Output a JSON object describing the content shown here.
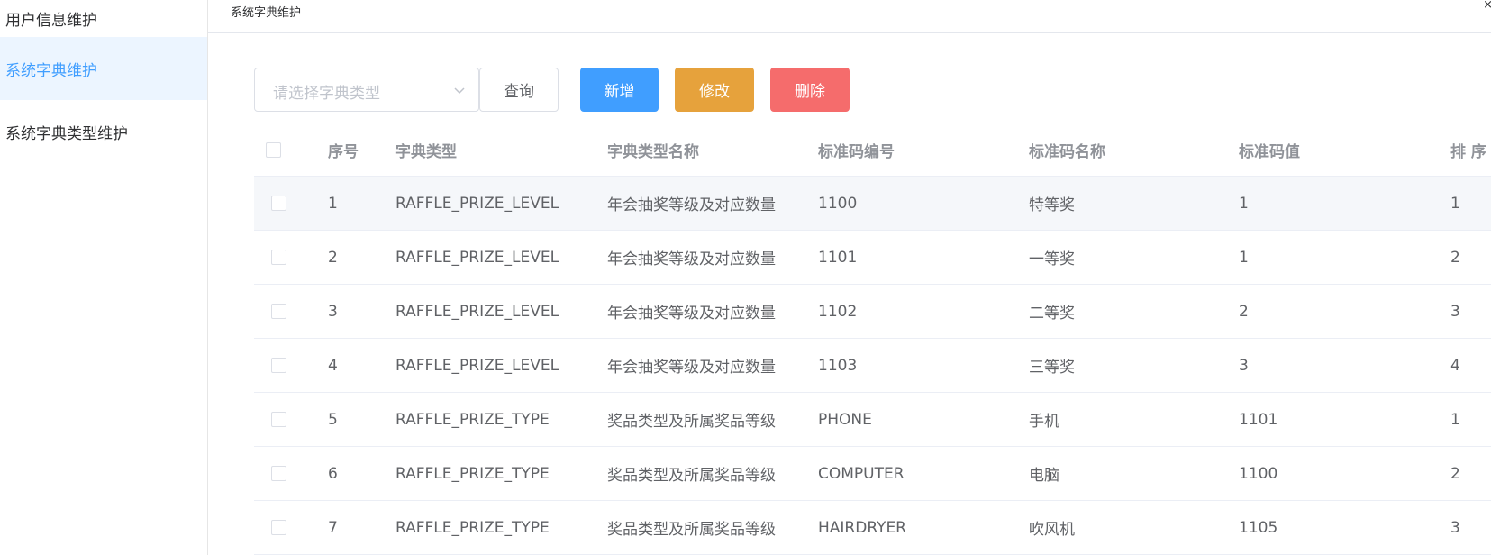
{
  "sidebar": {
    "items": [
      {
        "label": "用户信息维护",
        "active": false
      },
      {
        "label": "系统字典维护",
        "active": true
      },
      {
        "label": "系统字典类型维护",
        "active": false
      }
    ]
  },
  "tab": {
    "title": "系统字典维护",
    "close": "×"
  },
  "toolbar": {
    "select_placeholder": "请选择字典类型",
    "query_label": "查询",
    "add_label": "新增",
    "edit_label": "修改",
    "delete_label": "删除"
  },
  "table": {
    "headers": {
      "index": "序号",
      "dict_type": "字典类型",
      "dict_type_name": "字典类型名称",
      "code": "标准码编号",
      "code_name": "标准码名称",
      "code_value": "标准码值",
      "sort": "排 序"
    },
    "rows": [
      {
        "index": "1",
        "dict_type": "RAFFLE_PRIZE_LEVEL",
        "dict_type_name": "年会抽奖等级及对应数量",
        "code": "1100",
        "code_name": "特等奖",
        "code_value": "1",
        "sort": "1"
      },
      {
        "index": "2",
        "dict_type": "RAFFLE_PRIZE_LEVEL",
        "dict_type_name": "年会抽奖等级及对应数量",
        "code": "1101",
        "code_name": "一等奖",
        "code_value": "1",
        "sort": "2"
      },
      {
        "index": "3",
        "dict_type": "RAFFLE_PRIZE_LEVEL",
        "dict_type_name": "年会抽奖等级及对应数量",
        "code": "1102",
        "code_name": "二等奖",
        "code_value": "2",
        "sort": "3"
      },
      {
        "index": "4",
        "dict_type": "RAFFLE_PRIZE_LEVEL",
        "dict_type_name": "年会抽奖等级及对应数量",
        "code": "1103",
        "code_name": "三等奖",
        "code_value": "3",
        "sort": "4"
      },
      {
        "index": "5",
        "dict_type": "RAFFLE_PRIZE_TYPE",
        "dict_type_name": "奖品类型及所属奖品等级",
        "code": "PHONE",
        "code_name": "手机",
        "code_value": "1101",
        "sort": "1"
      },
      {
        "index": "6",
        "dict_type": "RAFFLE_PRIZE_TYPE",
        "dict_type_name": "奖品类型及所属奖品等级",
        "code": "COMPUTER",
        "code_name": "电脑",
        "code_value": "1100",
        "sort": "2"
      },
      {
        "index": "7",
        "dict_type": "RAFFLE_PRIZE_TYPE",
        "dict_type_name": "奖品类型及所属奖品等级",
        "code": "HAIRDRYER",
        "code_name": "吹风机",
        "code_value": "1105",
        "sort": "3"
      }
    ]
  },
  "colors": {
    "primary": "#409eff",
    "warning": "#e6a23c",
    "danger": "#f56c6c",
    "active_bg": "#ecf5ff",
    "hover_row": "#f5f7fa"
  }
}
